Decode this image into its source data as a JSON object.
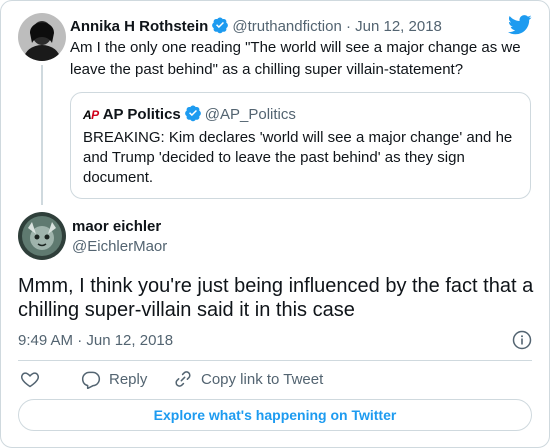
{
  "parent_tweet": {
    "author_name": "Annika H Rothstein",
    "handle": "@truthandfiction",
    "separator": "·",
    "date": "Jun 12, 2018",
    "text": "Am I the only one reading \"The world will see a major change as we leave the past behind\" as a chilling super villain-statement?",
    "quoted": {
      "logo_text": "AP",
      "author_name": "AP Politics",
      "handle": "@AP_Politics",
      "text": "BREAKING: Kim declares 'world will see a major change' and he and Trump 'decided to leave the past behind' as they sign document."
    }
  },
  "reply_tweet": {
    "author_name": "maor eichler",
    "handle": "@EichlerMaor",
    "text": "Mmm, I think you're just being influenced by the fact that a chilling super-villain said it in this case",
    "timestamp": "9:49 AM · Jun 12, 2018"
  },
  "actions": {
    "reply_label": "Reply",
    "copy_label": "Copy link to Tweet"
  },
  "footer": {
    "explore_label": "Explore what's happening on Twitter"
  },
  "colors": {
    "accent": "#1d9bf0",
    "text": "#0f1419",
    "muted": "#536471",
    "border": "#cfd9de",
    "ap_red": "#d0021b"
  },
  "icons": {
    "brand": "twitter-bird-icon",
    "verified": "verified-badge-icon",
    "info": "info-icon",
    "like": "heart-icon",
    "reply": "reply-bubble-icon",
    "copy": "link-icon"
  }
}
